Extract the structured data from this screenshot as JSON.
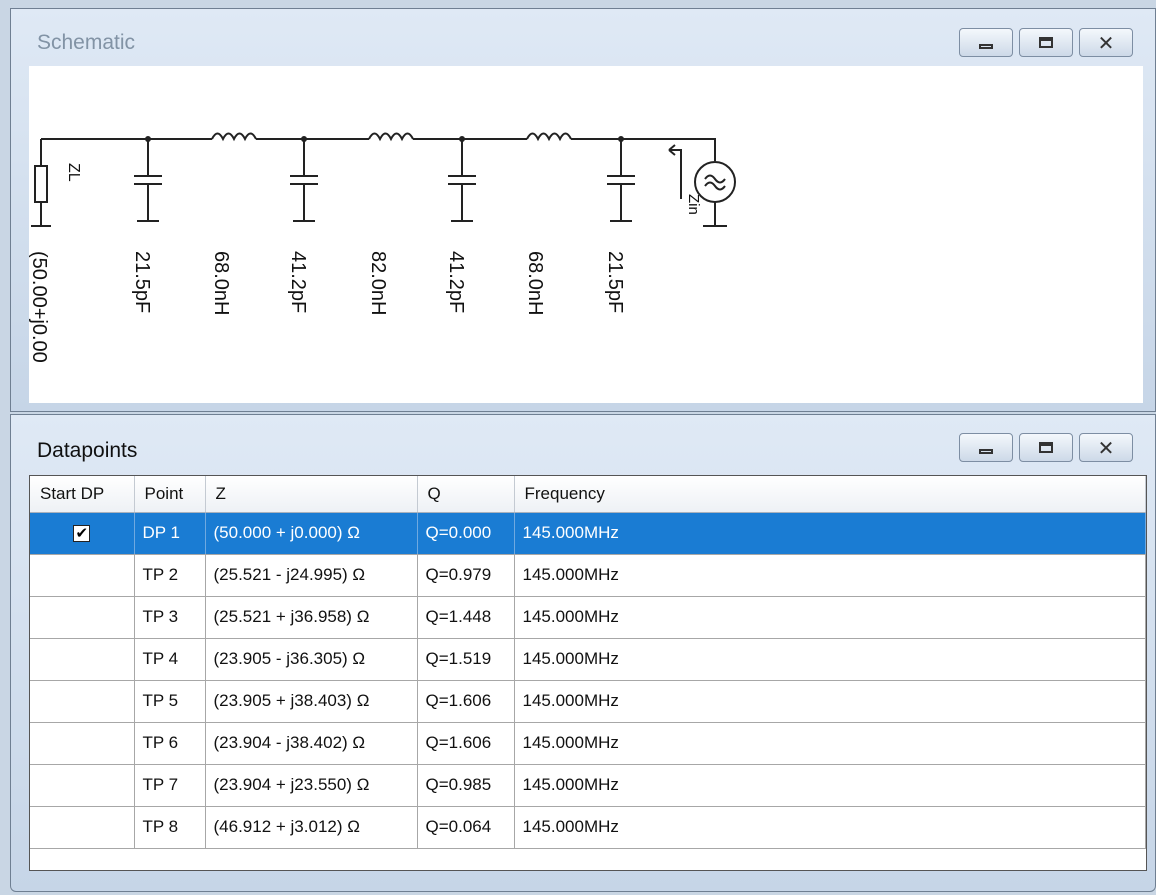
{
  "schematic": {
    "title": "Schematic",
    "load_symbol": "ZL",
    "load_value": "(50.00+j0.00",
    "components": [
      "21.5pF",
      "68.0nH",
      "41.2pF",
      "82.0nH",
      "41.2pF",
      "68.0nH",
      "21.5pF"
    ],
    "zin_label": "Zin",
    "source_icon": "ac-source-icon"
  },
  "datapoints": {
    "title": "Datapoints",
    "columns": [
      "Start DP",
      "Point",
      "Z",
      "Q",
      "Frequency"
    ],
    "rows": [
      {
        "start": true,
        "point": "DP 1",
        "z": "(50.000 + j0.000) Ω",
        "q": "Q=0.000",
        "freq": "145.000MHz",
        "selected": true
      },
      {
        "start": false,
        "point": "TP 2",
        "z": "(25.521 - j24.995) Ω",
        "q": "Q=0.979",
        "freq": "145.000MHz"
      },
      {
        "start": false,
        "point": "TP 3",
        "z": "(25.521 + j36.958) Ω",
        "q": "Q=1.448",
        "freq": "145.000MHz"
      },
      {
        "start": false,
        "point": "TP 4",
        "z": "(23.905 - j36.305) Ω",
        "q": "Q=1.519",
        "freq": "145.000MHz"
      },
      {
        "start": false,
        "point": "TP 5",
        "z": "(23.905 + j38.403) Ω",
        "q": "Q=1.606",
        "freq": "145.000MHz"
      },
      {
        "start": false,
        "point": "TP 6",
        "z": "(23.904 - j38.402) Ω",
        "q": "Q=1.606",
        "freq": "145.000MHz"
      },
      {
        "start": false,
        "point": "TP 7",
        "z": "(23.904 + j23.550) Ω",
        "q": "Q=0.985",
        "freq": "145.000MHz"
      },
      {
        "start": false,
        "point": "TP 8",
        "z": "(46.912 + j3.012) Ω",
        "q": "Q=0.064",
        "freq": "145.000MHz"
      }
    ]
  },
  "window_controls": {
    "minimize": "minimize-icon",
    "maximize": "maximize-icon",
    "close": "close-icon"
  },
  "colors": {
    "selection": "#1a7cd3",
    "titlebar": "#d4e1f0"
  }
}
